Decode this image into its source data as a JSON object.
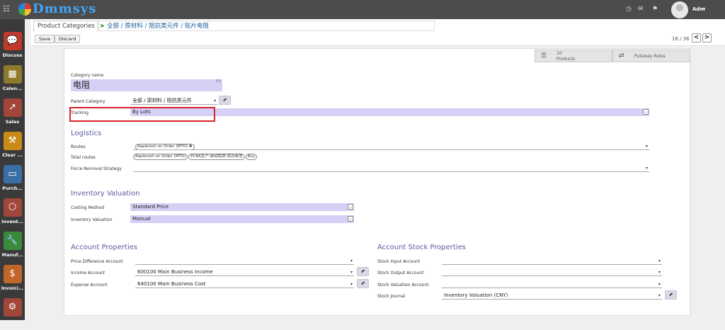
{
  "topbar": {
    "brand": "Dmmsys",
    "user": "Adm",
    "icons": {
      "apps": "apps-grid-icon",
      "clock": "clock-icon",
      "chat": "chat-icon",
      "gift": "gift-icon"
    }
  },
  "sidebar": {
    "items": [
      {
        "label": "Discuss",
        "color": "#c0392b",
        "glyph": "💬",
        "icon": "chat-bubble-icon"
      },
      {
        "label": "Calen...",
        "color": "#8e7a2b",
        "glyph": "▦",
        "icon": "calendar-icon"
      },
      {
        "label": "Sales",
        "color": "#a0463a",
        "glyph": "↗",
        "icon": "sales-chart-icon"
      },
      {
        "label": "Clear ...",
        "color": "#c98a17",
        "glyph": "⚒",
        "icon": "clear-icon"
      },
      {
        "label": "Purch...",
        "color": "#3a6ea5",
        "glyph": "▭",
        "icon": "purchase-card-icon"
      },
      {
        "label": "Invent...",
        "color": "#a0463a",
        "glyph": "⬡",
        "icon": "inventory-box-icon"
      },
      {
        "label": "Manuf...",
        "color": "#3a8a3a",
        "glyph": "🔧",
        "icon": "wrench-icon"
      },
      {
        "label": "Invoici...",
        "color": "#c0662b",
        "glyph": "$",
        "icon": "invoice-icon"
      },
      {
        "label": "",
        "color": "#a0463a",
        "glyph": "⚙",
        "icon": "settings-icon"
      }
    ]
  },
  "breadcrumb": {
    "root": "Product Categories",
    "path": "全部 / 原材料 / 阻抗类元件 / 贴片电阻"
  },
  "buttons": {
    "save": "Save",
    "discard": "Discard"
  },
  "pager": {
    "text": "16 / 36",
    "prev": "<",
    "next": ">"
  },
  "stats": [
    {
      "value": "10",
      "label": "Products",
      "icon": "list-icon"
    },
    {
      "label": "Putaway Rules",
      "icon": "shuffle-icon"
    }
  ],
  "form": {
    "category_name_label": "Category name",
    "category_name": "电阻",
    "lang": "EN",
    "parent_category_label": "Parent Category",
    "parent_category": "全部 / 原材料 / 阻抗类元件",
    "tracking_label": "Tracking",
    "tracking": "By Lots",
    "logistics_title": "Logistics",
    "routes_label": "Routes",
    "routes": [
      "Replenish on Order (MTO)"
    ],
    "total_routes_label": "Total routes",
    "total_routes": [
      "Replenish on Order (MTO)",
      "PCBA生产-启动库房-库存标签",
      "Buy"
    ],
    "removal_label": "Force Removal Strategy",
    "inventory_valuation_title": "Inventory Valuation",
    "costing_method_label": "Costing Method",
    "costing_method": "Standard Price",
    "inventory_valuation_label": "Inventory Valuation",
    "inventory_valuation": "Manual",
    "account_properties_title": "Account Properties",
    "price_diff_label": "Price Difference Account",
    "income_label": "Income Account",
    "income": "600100 Main Business Income",
    "expense_label": "Expense Account",
    "expense": "640100 Main Business Cost",
    "stock_props_title": "Account Stock Properties",
    "stock_input_label": "Stock Input Account",
    "stock_output_label": "Stock Output Account",
    "stock_valuation_label": "Stock Valuation Account",
    "stock_journal_label": "Stock Journal",
    "stock_journal": "Inventory Valuation (CNY)"
  },
  "colors": {
    "highlight": "#d8232a",
    "required_field": "#d5d0f5",
    "section_title": "#5b5ba0"
  }
}
